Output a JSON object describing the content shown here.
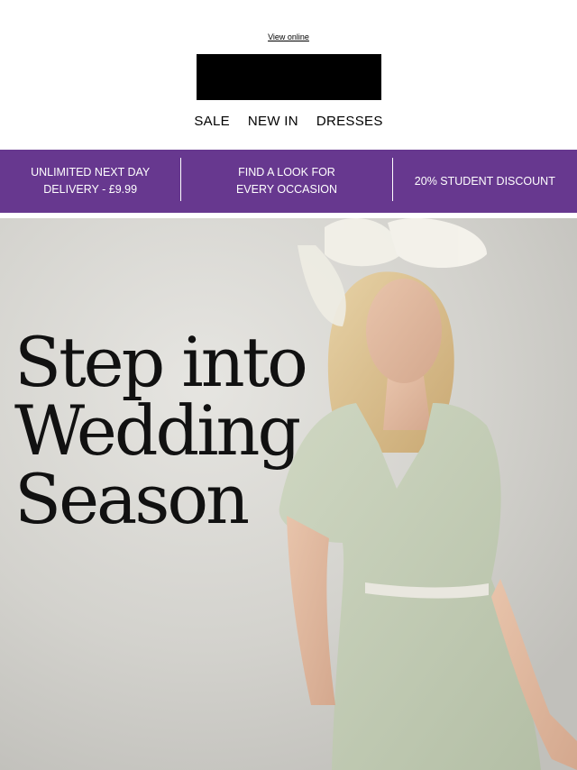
{
  "header": {
    "view_online": "View online",
    "nav": [
      "SALE",
      "NEW IN",
      "DRESSES"
    ]
  },
  "banner": {
    "background": "#67388f",
    "items": [
      {
        "line1": "UNLIMITED NEXT DAY",
        "line2": "DELIVERY - £9.99"
      },
      {
        "line1": "FIND A LOOK FOR",
        "line2": "EVERY OCCASION"
      },
      {
        "line1": "20% STUDENT DISCOUNT",
        "line2": ""
      }
    ]
  },
  "hero": {
    "title_lines": [
      "Step into",
      "Wedding",
      "Season"
    ]
  }
}
